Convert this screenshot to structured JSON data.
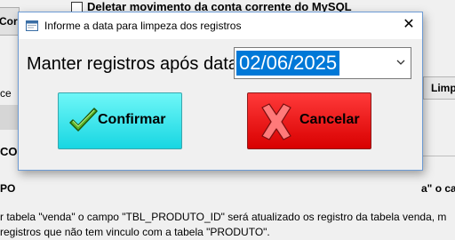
{
  "background": {
    "top_button_label": "Corre",
    "checkbox_label": "Deletar movimento da conta corrente do MySQL",
    "left_text_ce": "ce",
    "left_text_t": "t",
    "left_text_co": "CO",
    "left_text_po": "PO",
    "tab_limp": "Limp",
    "right_text": "a\" o ca",
    "bottom_line1": "r tabela \"venda\" o campo \"TBL_PRODUTO_ID\" será atualizado os registro da tabela venda, m",
    "bottom_line2": "registros que não tem vinculo com a tabela \"PRODUTO\"."
  },
  "dialog": {
    "title": "Informe a data para limpeza dos registros",
    "close_glyph": "✕",
    "field_label": "Manter registros após data:",
    "date_value": "02/06/2025",
    "confirm_label": "Confirmar",
    "cancel_label": "Cancelar"
  },
  "colors": {
    "confirm_bg": "#18d6e2",
    "cancel_bg": "#d80000",
    "selection": "#0078d7"
  }
}
